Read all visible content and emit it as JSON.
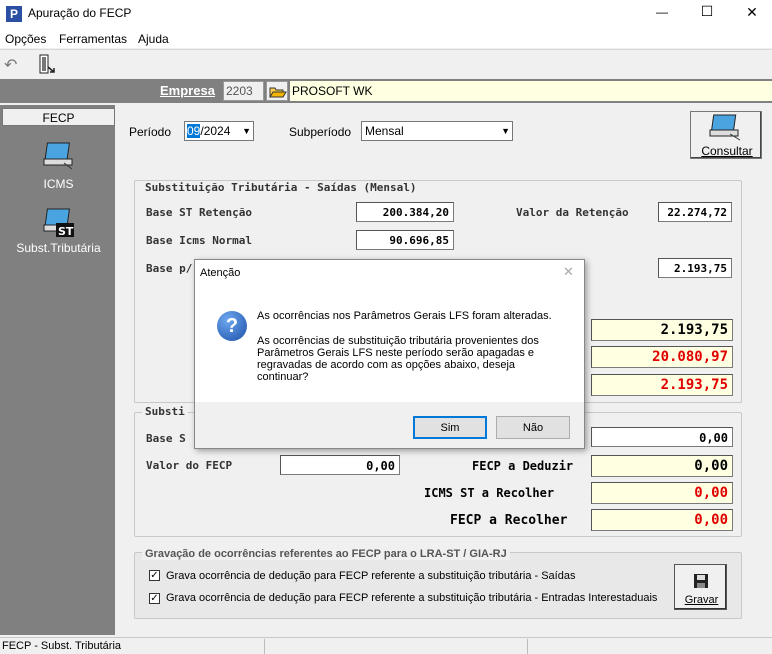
{
  "window": {
    "title": "Apuração do FECP",
    "logo_letter": "P"
  },
  "menu": [
    "Opções",
    "Ferramentas",
    "Ajuda"
  ],
  "empresa": {
    "label": "Empresa",
    "code": "2203",
    "name": "PROSOFT WK"
  },
  "sidebar": {
    "header": "FECP",
    "items": [
      {
        "label": "ICMS",
        "icon": "computer-icon"
      },
      {
        "label": "Subst.Tributária",
        "icon": "st-computer-icon",
        "badge": "ST"
      }
    ]
  },
  "period": {
    "label": "Período",
    "value_highlight": "09",
    "value_rest": "/2024",
    "sub_label": "Subperíodo",
    "sub_value": "Mensal",
    "consult_label": "Consultar"
  },
  "saidas": {
    "title": "Substituição Tributária - Saídas (Mensal)",
    "base_st_label": "Base ST Retenção",
    "base_st": "200.384,20",
    "valor_ret_label": "Valor da Retenção",
    "valor_ret": "22.274,72",
    "base_icms_label": "Base Icms Normal",
    "base_icms": "90.696,85",
    "base_p_label": "Base p/",
    "value_right": "2.193,75",
    "y1": "2.193,75",
    "y2": "20.080,97",
    "y3": "2.193,75"
  },
  "sub2": {
    "title_partial": "Substi",
    "base_partial": "Base S",
    "base_value": "0,00",
    "valor_fecp_label": "Valor do FECP",
    "valor_fecp": "0,00",
    "deduzir_label": "FECP a Deduzir",
    "deduzir": "0,00",
    "icms_label": "ICMS ST a Recolher",
    "icms": "0,00",
    "fecp_label": "FECP a Recolher",
    "fecp": "0,00"
  },
  "gravacao": {
    "title": "Gravação de ocorrências referentes ao FECP  para o LRA-ST / GIA-RJ",
    "cb1": "Grava ocorrência de dedução para FECP referente a substituição tributária - Saídas",
    "cb2": "Grava ocorrência de dedução para FECP referente a substituição tributária - Entradas Interestaduais",
    "save_label": "Gravar",
    "cb1_checked": true,
    "cb2_checked": true
  },
  "dialog": {
    "title": "Atenção",
    "line1": "As ocorrências nos Parâmetros Gerais LFS foram alteradas.",
    "line2": "As ocorrências de substituição tributária provenientes dos Parâmetros Gerais LFS neste período serão apagadas e regravadas de acordo com as opções abaixo, deseja continuar?",
    "yes": "Sim",
    "no": "Não",
    "icon_glyph": "?"
  },
  "status": {
    "text": "FECP - Subst. Tributária"
  },
  "icons": {
    "undo": "↶",
    "close": "✕",
    "minimize": "—",
    "maximize": "☐"
  }
}
